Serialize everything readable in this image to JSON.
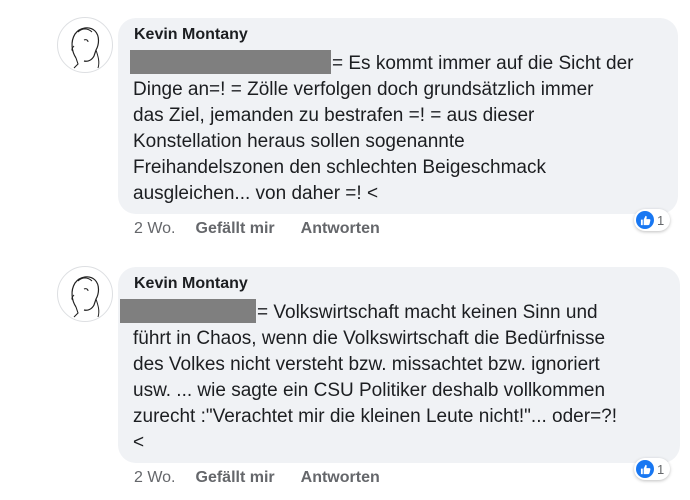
{
  "comments": [
    {
      "author": "Kevin Montany",
      "lines": [
        "= Es kommt immer auf die Sicht der",
        "Dinge an=! = Zölle verfolgen doch grundsätzlich immer",
        "das Ziel, jemanden zu bestrafen =! = aus dieser",
        "Konstellation heraus sollen sogenannte",
        "Freihandelszonen den schlechten  Beigeschmack",
        "ausgleichen... von daher =! <"
      ],
      "time": "2 Wo.",
      "like_label": "Gefällt mir",
      "reply_label": "Antworten",
      "reaction_count": "1",
      "reaction_icon": "thumbs-up-icon"
    },
    {
      "author": "Kevin Montany",
      "lines": [
        "=  Volkswirtschaft macht keinen Sinn und",
        "führt in Chaos, wenn die Volkswirtschaft die Bedürfnisse",
        "des Volkes nicht versteht bzw. missachtet bzw. ignoriert",
        "usw. ... wie sagte ein CSU Politiker deshalb vollkommen",
        "zurecht :\"Verachtet mir die kleinen Leute nicht!\"... oder=?!",
        "<"
      ],
      "time": "2 Wo.",
      "like_label": "Gefällt mir",
      "reply_label": "Antworten",
      "reaction_count": "1",
      "reaction_icon": "thumbs-up-icon"
    }
  ],
  "colors": {
    "bubble": "#f0f2f5",
    "redaction": "#7f7f7f",
    "like_blue": "#1877f2",
    "meta_gray": "#65676b"
  }
}
